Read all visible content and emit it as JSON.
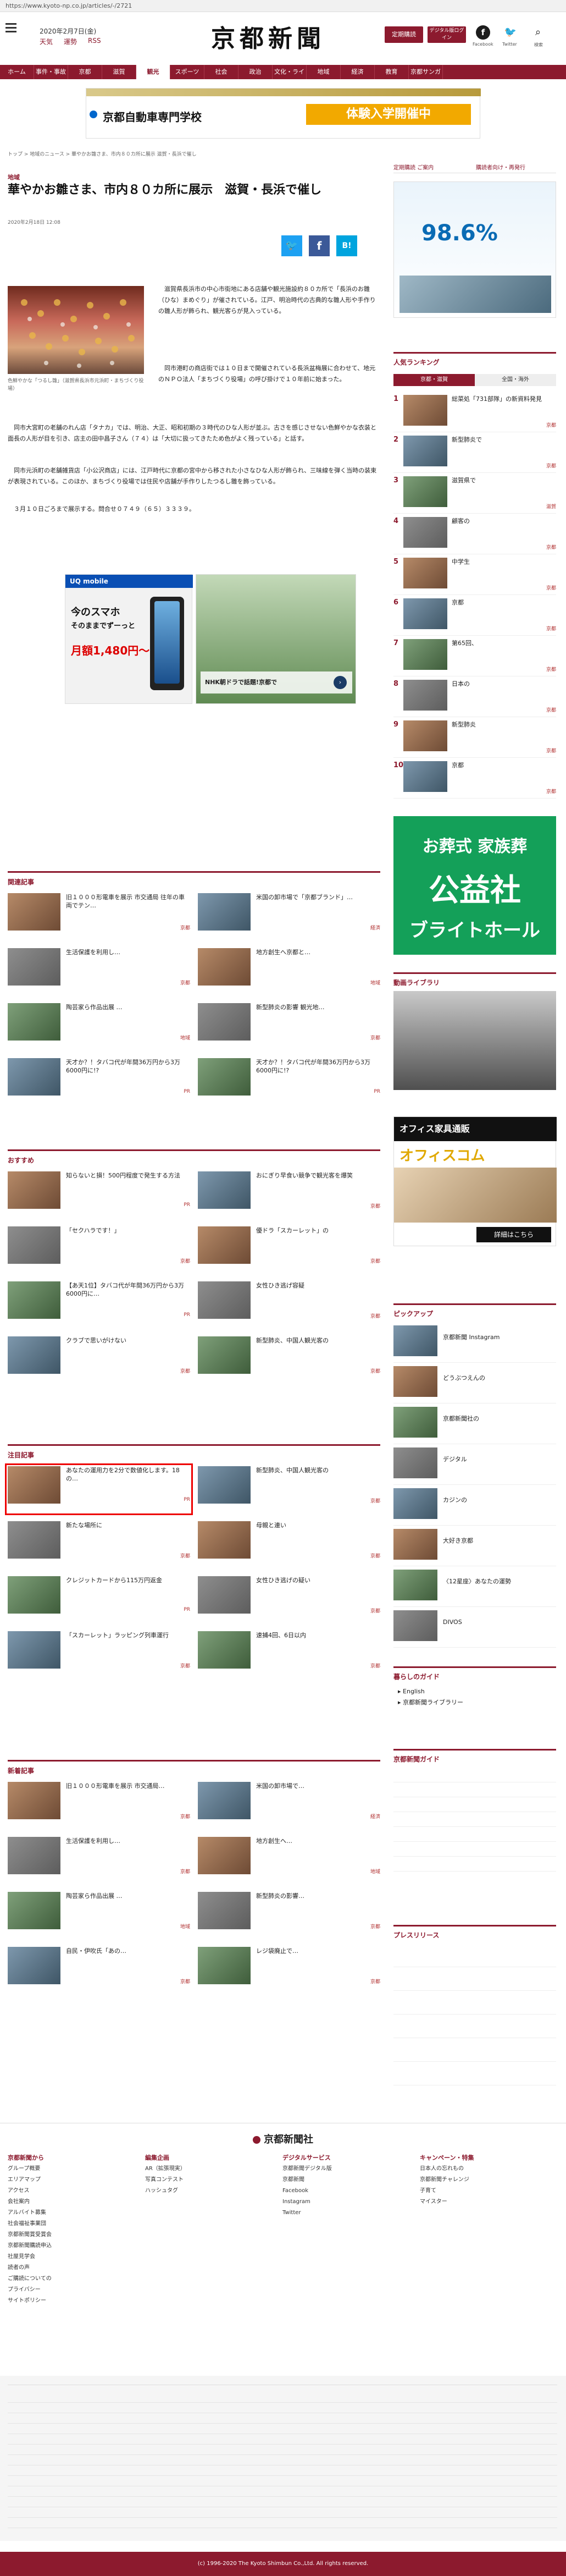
{
  "browser": {
    "url": "https://www.kyoto-np.co.jp/articles/-/2721"
  },
  "header": {
    "date": "2020年2月7日(金)",
    "weather": "天気",
    "horoscope": "運勢",
    "rss": "RSS",
    "logo": "京都新聞",
    "subscribe_btn": "定期購読",
    "digital_btn": "デジタル版ログイン",
    "social": [
      "Facebook",
      "Twitter",
      "検索"
    ]
  },
  "nav": {
    "items": [
      "ホーム",
      "事件・事故",
      "京都",
      "滋賀",
      "観光",
      "スポーツ",
      "社会",
      "政治",
      "文化・ライフ",
      "地域",
      "経済",
      "教育",
      "京都サンガ"
    ],
    "active_index": 4
  },
  "ad_top": {
    "name": "京都自動車専門学校",
    "cta": "体験入学開催中"
  },
  "breadcrumb": "トップ > 地域のニュース > 華やかお雛さま、市内８０カ所に展示 滋賀・長浜で催し",
  "article": {
    "category": "地域",
    "title": "華やかお雛さま、市内８０カ所に展示　滋賀・長浜で催し",
    "date": "2020年2月18日 12:08",
    "share": [
      "Twitter",
      "Facebook",
      "B!"
    ],
    "photo_caption": "色鮮やかな「つるし雛」（滋賀県長浜市元浜町・まちづくり役場）",
    "paragraphs": [
      "滋賀県長浜市の中心市街地にある店舗や観光施設約８０カ所で「長浜のお雛（ひな）まめぐり」が催されている。江戸、明治時代の古典的な雛人形や手作りの雛人形が飾られ、観光客らが見入っている。",
      "同市港町の商店街では１０日まで開催されている長浜盆梅展に合わせて、地元のＮＰＯ法人「まちづくり役場」の呼び掛けで１０年前に始まった。",
      "同市大宮町の老舗のれん店「タナカ」では、明治、大正、昭和初期の３時代のひな人形が並ぶ。古さを感じさせない色鮮やかな衣装と面長の人形が目を引き、店主の田中昌子さん（７４）は「大切に扱ってきたため色がよく残っている」と話す。",
      "同市元浜町の老舗雑貨店「小公沢商店」には、江戸時代に京都の宮中から移された小さなひな人形が飾られ、三味線を弾く当時の装束が表現されている。このほか、まちづくり役場では住民や店舗が手作りしたつるし雛を飾っている。",
      "３月１０日ごろまで展示する。問合せ０７４９（６５）３３３９。"
    ]
  },
  "ads_mid": [
    {
      "brand": "UQ mobile",
      "line1": "今のスマホ",
      "line2": "そのままでずーっと",
      "price": "月額1,480円〜"
    },
    {
      "caption": "NHK朝ドラで話題!京都で"
    }
  ],
  "related": {
    "title": "関連記事",
    "items": [
      {
        "text": "旧１０００形電車を展示 市交通局 往年の車両でテン…",
        "cat": "京都"
      },
      {
        "text": "米国の卸市場で「京都ブランド」…",
        "cat": "経済"
      },
      {
        "text": "生活保護を利用し…",
        "cat": "京都"
      },
      {
        "text": "地方創生へ京都と…",
        "cat": "地域"
      },
      {
        "text": "陶芸家ら作品出展 …",
        "cat": "地域"
      },
      {
        "text": "新型肺炎の影響 観光地…",
        "cat": "京都"
      },
      {
        "text": "天才か？！タバコ代が年間36万円から3万6000円に!?",
        "cat": "PR"
      },
      {
        "text": "天才か？！タバコ代が年間36万円から3万6000円に!?",
        "cat": "PR"
      }
    ]
  },
  "osusume": {
    "title": "おすすめ",
    "items": [
      {
        "text": "知らないと損！500円程度で発生する方法",
        "cat": "PR"
      },
      {
        "text": "おにぎり早食い競争で観光客を爆笑",
        "cat": "京都"
      },
      {
        "text": "「セクハラです！」",
        "cat": "京都"
      },
      {
        "text": "優ドラ「スカーレット」の",
        "cat": "京都"
      },
      {
        "text": "【あ天1位】タバコ代が年間36万円から3万6000円に…",
        "cat": "PR"
      },
      {
        "text": "女性ひき逃げ容疑",
        "cat": "京都"
      },
      {
        "text": "クラブで思いがけない",
        "cat": "京都"
      },
      {
        "text": "新型肺炎、中国人観光客の",
        "cat": "京都"
      }
    ]
  },
  "chumoku": {
    "title": "注目記事",
    "items": [
      {
        "text": "あなたの運用力を2分で数値化します。18の…",
        "cat": "PR"
      },
      {
        "text": "新型肺炎、中国人観光客の",
        "cat": "京都"
      },
      {
        "text": "新たな場所に",
        "cat": "京都"
      },
      {
        "text": "母親と連い",
        "cat": "京都"
      },
      {
        "text": "クレジットカードから115万円返金",
        "cat": "PR"
      },
      {
        "text": "女性ひき逃げの疑い",
        "cat": "京都"
      },
      {
        "text": "「スカーレット」ラッピング列車運行",
        "cat": "京都"
      },
      {
        "text": "速捕4回、6日以内",
        "cat": "京都"
      }
    ]
  },
  "shinchaku": {
    "title": "新着記事",
    "items": [
      {
        "text": "旧１０００形電車を展示 市交通局…",
        "cat": "京都"
      },
      {
        "text": "米国の卸市場で…",
        "cat": "経済"
      },
      {
        "text": "生活保護を利用し…",
        "cat": "京都"
      },
      {
        "text": "地方創生へ…",
        "cat": "地域"
      },
      {
        "text": "陶芸家ら作品出展 …",
        "cat": "地域"
      },
      {
        "text": "新型肺炎の影響…",
        "cat": "京都"
      },
      {
        "text": "自民・伊吹氏「あの…",
        "cat": "京都"
      },
      {
        "text": "レジ袋廃止で…",
        "cat": "京都"
      }
    ]
  },
  "sidebar": {
    "subscribe_links": [
      "定期購読 ご案内",
      "購読者向け・再発行"
    ],
    "ad_rate": "98.6%",
    "ranking": {
      "title": "人気ランキング",
      "tabs": [
        "京都・滋賀",
        "全国・海外"
      ],
      "items": [
        {
          "text": "総菜処「731部隊」の新資料発見",
          "cat": "京都"
        },
        {
          "text": "新型肺炎で",
          "cat": "京都"
        },
        {
          "text": "滋賀県で",
          "cat": "滋賀"
        },
        {
          "text": "顧客の",
          "cat": "京都"
        },
        {
          "text": "中学生",
          "cat": "京都"
        },
        {
          "text": "京都",
          "cat": "京都"
        },
        {
          "text": "第65回、",
          "cat": "京都"
        },
        {
          "text": "日本の",
          "cat": "京都"
        },
        {
          "text": "新型肺炎",
          "cat": "京都"
        },
        {
          "text": "京都",
          "cat": "京都"
        }
      ]
    },
    "ad_funeral": {
      "line1": "お葬式 家族葬",
      "line2": "公益社",
      "line3": "ブライトホール"
    },
    "photo_library": {
      "title": "動画ライブラリ"
    },
    "office_ad": {
      "line1": "オフィス家具通販",
      "line2": "オフィスコム",
      "cta": "詳細はこちら"
    },
    "pickup": {
      "title": "ピックアップ",
      "items": [
        "京都新聞 Instagram",
        "どうぶつえんの",
        "京都新聞社の",
        "デジタル",
        "カジンの",
        "大好き京都",
        "〈12星座〉あなたの運勢",
        "DIVOS"
      ]
    },
    "kurashi": {
      "title": "暮らしのガイド",
      "items": [
        "English",
        "京都新聞ライブラリー"
      ]
    },
    "info": {
      "title": "京都新聞ガイド"
    },
    "press": {
      "title": "プレスリリース"
    }
  },
  "footer": {
    "logo": "京都新聞社",
    "cols": [
      {
        "title": "京都新聞から",
        "items": [
          "グループ概要",
          "エリアマップ",
          "アクセス",
          "会社案内",
          "アルバイト募集",
          "社会福祉事業団",
          "京都新聞賞受賞会",
          "京都新聞購読申込",
          "社屋見学会",
          "読者の声",
          "ご購読についての",
          "プライバシー",
          "サイトポリシー"
        ]
      },
      {
        "title": "編集企画",
        "items": [
          "AR（拡張現実）",
          "写真コンテスト",
          "ハッシュタグ"
        ]
      },
      {
        "title": "デジタルサービス",
        "items": [
          "京都新聞デジタル版",
          "京都新聞",
          "Facebook",
          "Instagram",
          "Twitter"
        ]
      },
      {
        "title": "キャンペーン・特集",
        "items": [
          "日本人の忘れもの",
          "京都新聞チャレンジ",
          "子育て",
          "マイスター"
        ]
      }
    ],
    "copyright": "(c) 1996-2020 The Kyoto Shimbun Co.,Ltd. All rights reserved."
  }
}
